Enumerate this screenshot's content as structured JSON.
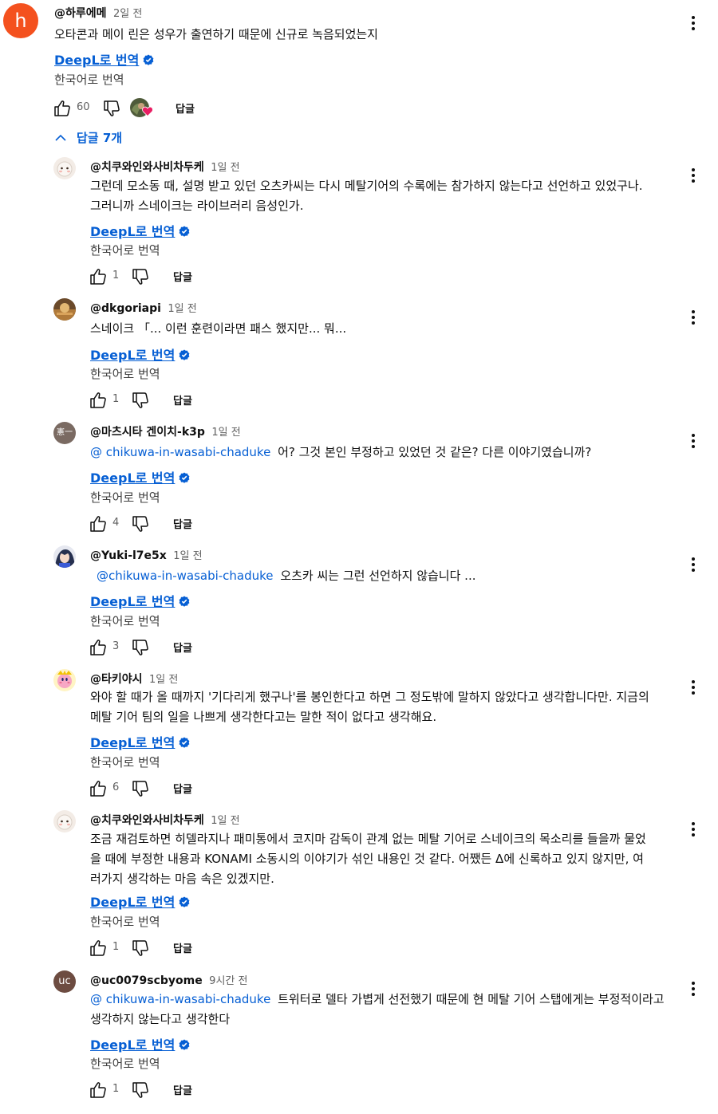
{
  "colors": {
    "link": "#065fd4",
    "text": "#0f0f0f",
    "secondary": "#606060",
    "top_avatar_bg": "#f4511e",
    "heart": "#e91e63",
    "verified": "#065fd4"
  },
  "common": {
    "translate_link": "DeepL로 번역",
    "translate_label": "한국어로 번역",
    "reply_label": "답글"
  },
  "top_comment": {
    "avatar_letter": "h",
    "author": "@하루에메",
    "time": "2일 전",
    "text": "오타콘과 메이 린은 성우가 출연하기 때문에 신규로 녹음되었는지",
    "likes": "60"
  },
  "replies_toggle": {
    "label": "답글 7개",
    "icon": "chevron-up-icon"
  },
  "replies": [
    {
      "author": "@치쿠와인와사비차두케",
      "time": "1일 전",
      "mention": "",
      "lines": [
        "그런데 모소동 때, 설명 받고 있던 오츠카씨는 다시 메탈기어의 수록에는 참가하지 않는다고 선언하고 있었구나.",
        "그러니까 스네이크는 라이브러리 음성인가."
      ],
      "likes": "1",
      "avatar": "cartoon-avatar"
    },
    {
      "author": "@dkgoriapi",
      "time": "1일 전",
      "mention": "",
      "lines": [
        "스네이크 「... 이런 훈련이라면 패스 했지만... 뭐..."
      ],
      "likes": "1",
      "avatar": "photo-avatar"
    },
    {
      "author": "@마츠시타 겐이치-k3p",
      "time": "1일 전",
      "mention": "@ chikuwa-in-wasabi-chaduke",
      "lines": [
        "어? 그것 본인 부정하고 있었던 것 같은? 다른 이야기였습니까?"
      ],
      "likes": "4",
      "avatar": "kanji-avatar",
      "avatar_text": "憲一"
    },
    {
      "author": "@Yuki-l7e5x",
      "time": "1일 전",
      "mention": "@chikuwa-in-wasabi-chaduke",
      "lines": [
        "오츠카 씨는 그런 선언하지 않습니다 ..."
      ],
      "likes": "3",
      "avatar": "anime-avatar"
    },
    {
      "author": "@타키야시",
      "time": "1일 전",
      "mention": "",
      "lines": [
        "와야 할 때가 올 때까지 '기다리게 했구나'를 봉인한다고 하면 그 정도밖에 말하지 않았다고 생각합니다만. 지금의",
        "메탈 기어 팀의 일을 나쁘게 생각한다고는 말한 적이 없다고 생각해요."
      ],
      "likes": "6",
      "avatar": "kirby-avatar"
    },
    {
      "author": "@치쿠와인와사비차두케",
      "time": "1일 전",
      "mention": "",
      "lines": [
        "조금 재검토하면 히델라지나 패미통에서 코지마 감독이 관계 없는 메탈 기어로 스네이크의 목소리를 들을까 물었",
        "을 때에 부정한 내용과 KONAMI 소동시의 이야기가 섞인 내용인 것 같다. 어쨌든 Δ에 신록하고 있지 않지만, 여",
        "러가지 생각하는 마음 속은 있겠지만."
      ],
      "likes": "1",
      "avatar": "cartoon-avatar"
    },
    {
      "author": "@uc0079scbyome",
      "time": "9시간 전",
      "mention": "@ chikuwa-in-wasabi-chaduke",
      "lines": [
        "트위터로 델타 가볍게 선전했기 때문에 현 메탈 기어 스탭에게는 부정적이라고",
        "생각하지 않는다고 생각한다"
      ],
      "likes": "1",
      "avatar": "initials-avatar",
      "avatar_text": "uc"
    }
  ]
}
